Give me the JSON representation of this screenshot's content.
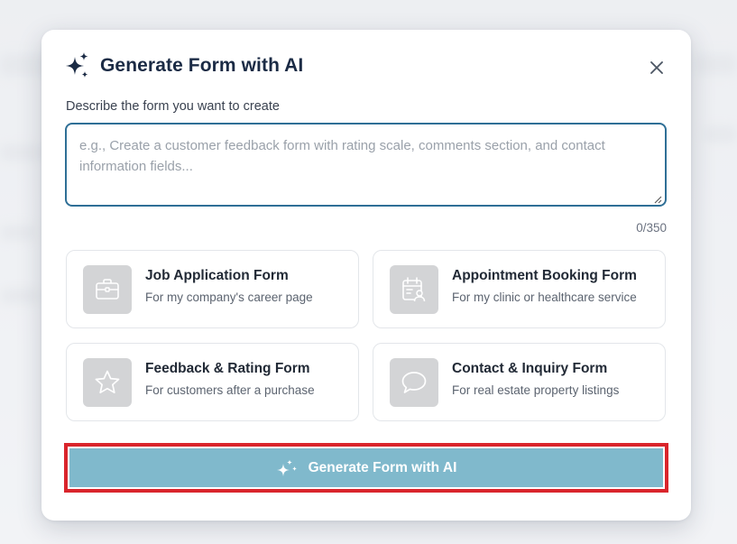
{
  "modal": {
    "title": "Generate Form with AI",
    "close_icon": "close-icon",
    "title_icon": "sparkles-icon"
  },
  "prompt": {
    "label": "Describe the form you want to create",
    "value": "",
    "placeholder": "e.g., Create a customer feedback form with rating scale, comments section, and contact information fields...",
    "char_count": "0/350"
  },
  "templates": [
    {
      "title": "Job Application Form",
      "subtitle": "For my company's career page",
      "icon": "briefcase-icon"
    },
    {
      "title": "Appointment Booking Form",
      "subtitle": "For my clinic or healthcare service",
      "icon": "calendar-user-icon"
    },
    {
      "title": "Feedback & Rating Form",
      "subtitle": "For customers after a purchase",
      "icon": "star-icon"
    },
    {
      "title": "Contact & Inquiry Form",
      "subtitle": "For real estate property listings",
      "icon": "chat-bubble-icon"
    }
  ],
  "generate": {
    "label": "Generate Form with AI",
    "icon": "sparkles-icon"
  },
  "colors": {
    "title": "#1b2b45",
    "textarea_border": "#2f6f96",
    "button_bg": "#80b9cc",
    "highlight_border": "#d9252c",
    "card_icon_bg": "#d3d4d6"
  }
}
